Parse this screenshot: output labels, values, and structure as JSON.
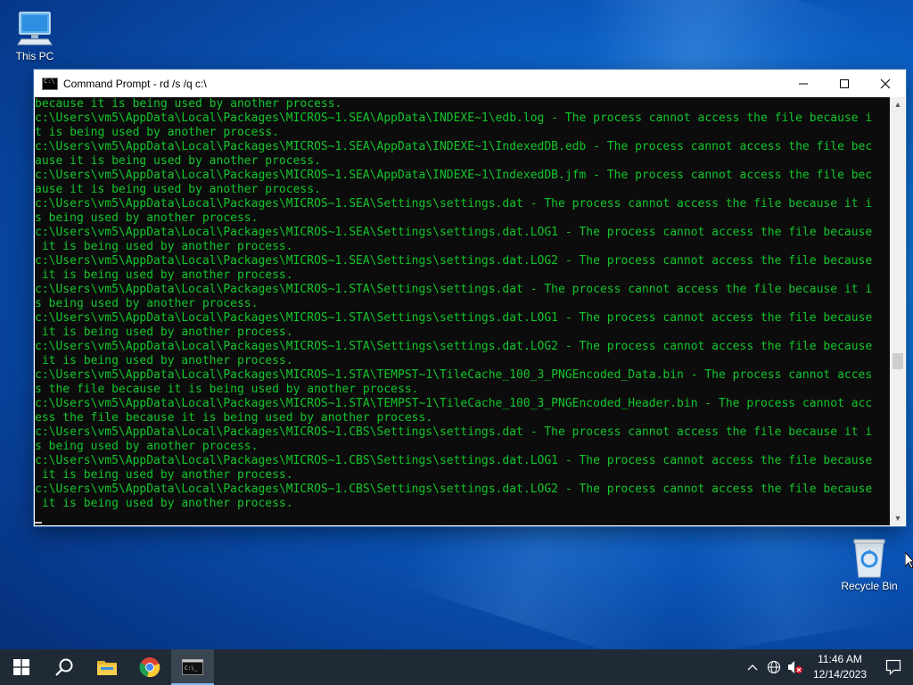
{
  "desktop": {
    "icons": [
      {
        "label": "This PC"
      },
      {
        "label": "Recycle Bin"
      }
    ]
  },
  "window": {
    "title": "Command Prompt - rd  /s /q c:\\",
    "controls": {
      "minimize": "minimize",
      "maximize": "maximize",
      "close": "close"
    }
  },
  "console": {
    "lines": [
      "because it is being used by another process.",
      "c:\\Users\\vm5\\AppData\\Local\\Packages\\MICROS~1.SEA\\AppData\\INDEXE~1\\edb.log - The process cannot access the file because i",
      "t is being used by another process.",
      "c:\\Users\\vm5\\AppData\\Local\\Packages\\MICROS~1.SEA\\AppData\\INDEXE~1\\IndexedDB.edb - The process cannot access the file bec",
      "ause it is being used by another process.",
      "c:\\Users\\vm5\\AppData\\Local\\Packages\\MICROS~1.SEA\\AppData\\INDEXE~1\\IndexedDB.jfm - The process cannot access the file bec",
      "ause it is being used by another process.",
      "c:\\Users\\vm5\\AppData\\Local\\Packages\\MICROS~1.SEA\\Settings\\settings.dat - The process cannot access the file because it i",
      "s being used by another process.",
      "c:\\Users\\vm5\\AppData\\Local\\Packages\\MICROS~1.SEA\\Settings\\settings.dat.LOG1 - The process cannot access the file because",
      " it is being used by another process.",
      "c:\\Users\\vm5\\AppData\\Local\\Packages\\MICROS~1.SEA\\Settings\\settings.dat.LOG2 - The process cannot access the file because",
      " it is being used by another process.",
      "c:\\Users\\vm5\\AppData\\Local\\Packages\\MICROS~1.STA\\Settings\\settings.dat - The process cannot access the file because it i",
      "s being used by another process.",
      "c:\\Users\\vm5\\AppData\\Local\\Packages\\MICROS~1.STA\\Settings\\settings.dat.LOG1 - The process cannot access the file because",
      " it is being used by another process.",
      "c:\\Users\\vm5\\AppData\\Local\\Packages\\MICROS~1.STA\\Settings\\settings.dat.LOG2 - The process cannot access the file because",
      " it is being used by another process.",
      "c:\\Users\\vm5\\AppData\\Local\\Packages\\MICROS~1.STA\\TEMPST~1\\TileCache_100_3_PNGEncoded_Data.bin - The process cannot acces",
      "s the file because it is being used by another process.",
      "c:\\Users\\vm5\\AppData\\Local\\Packages\\MICROS~1.STA\\TEMPST~1\\TileCache_100_3_PNGEncoded_Header.bin - The process cannot acc",
      "ess the file because it is being used by another process.",
      "c:\\Users\\vm5\\AppData\\Local\\Packages\\MICROS~1.CBS\\Settings\\settings.dat - The process cannot access the file because it i",
      "s being used by another process.",
      "c:\\Users\\vm5\\AppData\\Local\\Packages\\MICROS~1.CBS\\Settings\\settings.dat.LOG1 - The process cannot access the file because",
      " it is being used by another process.",
      "c:\\Users\\vm5\\AppData\\Local\\Packages\\MICROS~1.CBS\\Settings\\settings.dat.LOG2 - The process cannot access the file because",
      " it is being used by another process."
    ],
    "text_color": "#13c62b"
  },
  "taskbar": {
    "items": [
      {
        "icon": "windows-start-icon"
      },
      {
        "icon": "search-icon"
      },
      {
        "icon": "file-explorer-icon"
      },
      {
        "icon": "chrome-icon"
      },
      {
        "icon": "command-prompt-icon",
        "active": true
      }
    ],
    "tray": {
      "time": "11:46 AM",
      "date": "12/14/2023"
    }
  },
  "colors": {
    "taskbar": "#1f2a36",
    "accent": "#0a55b8"
  }
}
